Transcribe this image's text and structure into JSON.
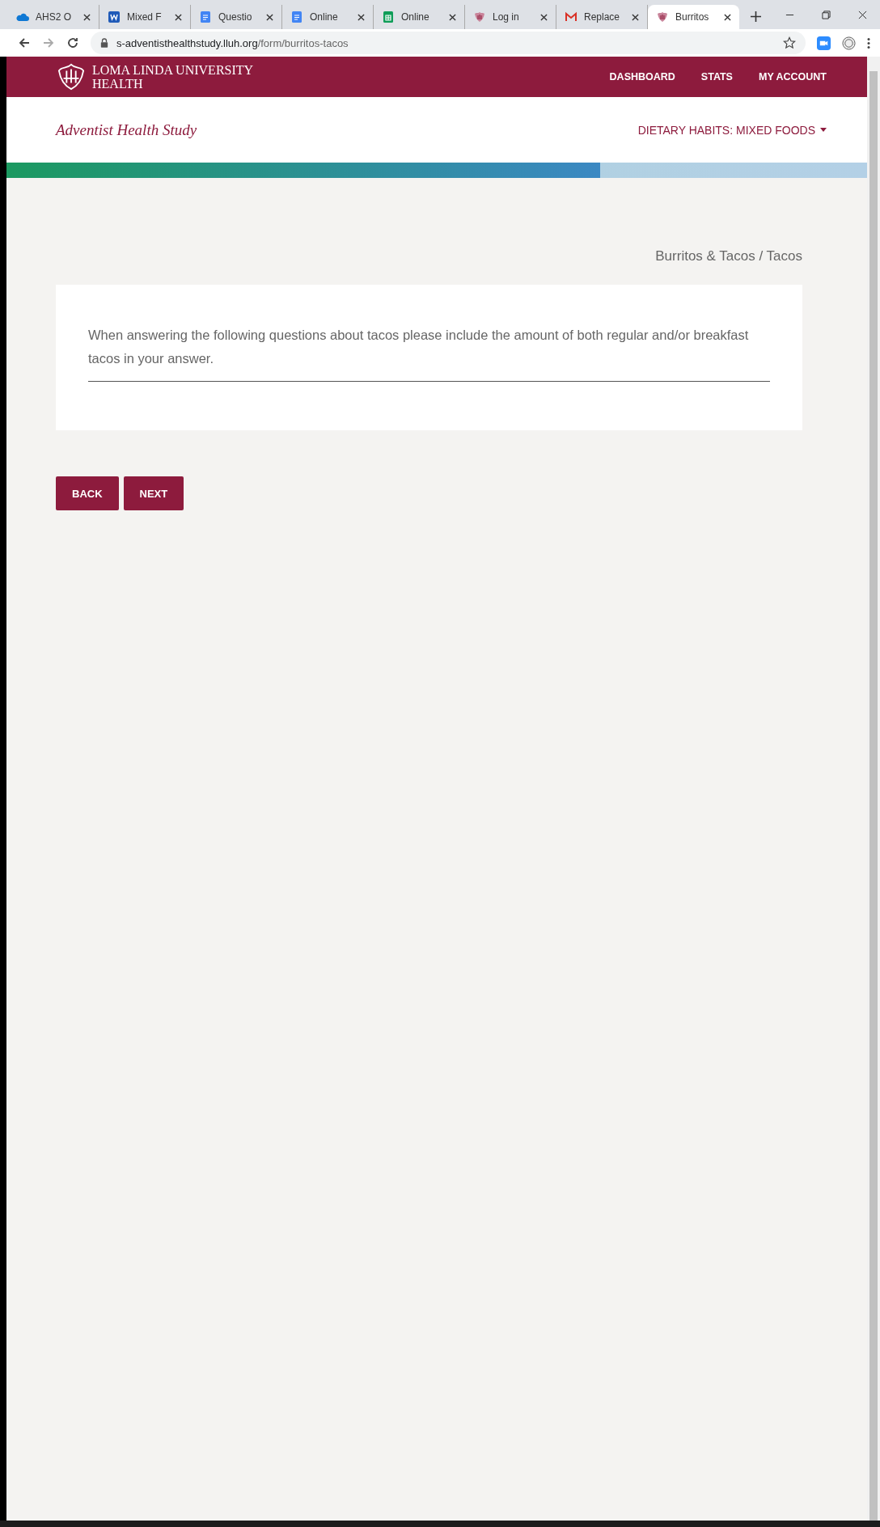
{
  "browser": {
    "tabs": [
      {
        "label": "AHS2 O",
        "kind": "cloud",
        "selected": false
      },
      {
        "label": "Mixed F",
        "kind": "word",
        "selected": false
      },
      {
        "label": "Questio",
        "kind": "doc",
        "selected": false
      },
      {
        "label": "Online",
        "kind": "doc",
        "selected": false
      },
      {
        "label": "Online",
        "kind": "sheet",
        "selected": false
      },
      {
        "label": "Log in",
        "kind": "crest",
        "selected": false
      },
      {
        "label": "Replace",
        "kind": "mail",
        "selected": false
      },
      {
        "label": "Burritos",
        "kind": "crest",
        "selected": true
      }
    ],
    "url": {
      "host": "s-adventisthealthstudy.lluh.org",
      "path": "/form/burritos-tacos"
    }
  },
  "site_header": {
    "brand": [
      "LOMA LINDA UNIVERSITY",
      "HEALTH"
    ],
    "nav": [
      "DASHBOARD",
      "STATS",
      "MY ACCOUNT"
    ]
  },
  "sub_header": {
    "title": "Adventist Health Study",
    "section_menu": "DIETARY HABITS: MIXED FOODS"
  },
  "progress": {
    "level": 0.69
  },
  "breadcrumb": "Burritos & Tacos / Tacos",
  "card": {
    "text": "When answering the following questions about tacos please include the amount of both regular and/or breakfast tacos in your answer."
  },
  "buttons": [
    "BACK",
    "NEXT"
  ]
}
